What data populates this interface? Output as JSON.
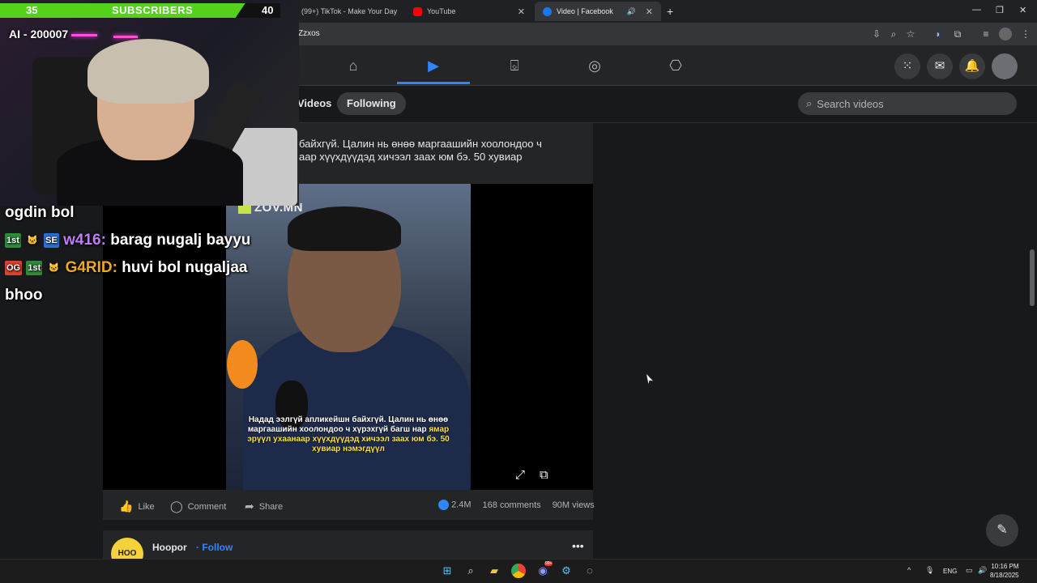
{
  "browser": {
    "tabs": [
      {
        "label": "(99+) TikTok - Make Your Day",
        "icon": "tiktok-icon"
      },
      {
        "label": "YouTube",
        "icon": "youtube-icon"
      },
      {
        "label": "Video | Facebook",
        "icon": "facebook-icon",
        "active": true
      }
    ],
    "url": "Zzxos"
  },
  "facebook": {
    "nav": [
      "home-icon",
      "watch-icon",
      "marketplace-icon",
      "groups-icon",
      "gaming-icon"
    ],
    "active_nav": "watch-icon",
    "subnav": {
      "videos_label": "Videos",
      "following_label": "Following",
      "search_placeholder": "Search videos"
    },
    "post": {
      "caption_line1": "байхгүй. Цалин нь өнөө маргаашийн хоолондоо ч",
      "caption_line2": "аар хүүхдүүдэд хичээл заах юм бэ. 50 хувиар",
      "watermark": "ZOV.MN",
      "subtitle_part1": "Надад ээлгүй апликейшн байхгүй. Цалин нь өнөө маргаашийн хоолондоо ч хүрэхгүй багш нар",
      "subtitle_highlight": "ямар эрүүл ухаанаар хүүхдүүдэд хичээл заах юм бэ. 50 хувиар нэмэгдүүл",
      "actions": {
        "like": "Like",
        "comment": "Comment",
        "share": "Share"
      },
      "stats": {
        "reactions": "2.4M",
        "comments": "168 comments",
        "views": "90M views"
      }
    },
    "next_post": {
      "author": "Hoopor",
      "follow": "· Follow",
      "avatar_text": "HOO"
    }
  },
  "overlay": {
    "subscribers": {
      "current": "35",
      "label": "SUBSCRIBERS",
      "goal": "40",
      "progress": 0.875
    },
    "ai_label": "AI - 200007",
    "chat": [
      {
        "user": "",
        "text": "ogdin bol"
      },
      {
        "badges": [
          "1st",
          "🐱",
          "SE"
        ],
        "user": "w416:",
        "text": "barag nugalj bayyu"
      },
      {
        "badges": [
          "OG",
          "1st",
          "🐱"
        ],
        "user": "G4RID:",
        "text": "huvi bol nugaljaa"
      },
      {
        "user": "",
        "text": "bhoo"
      }
    ]
  },
  "taskbar": {
    "lang": "ENG",
    "time": "10:16 PM",
    "date": "8/18/2025",
    "discord_badge": "99+"
  }
}
